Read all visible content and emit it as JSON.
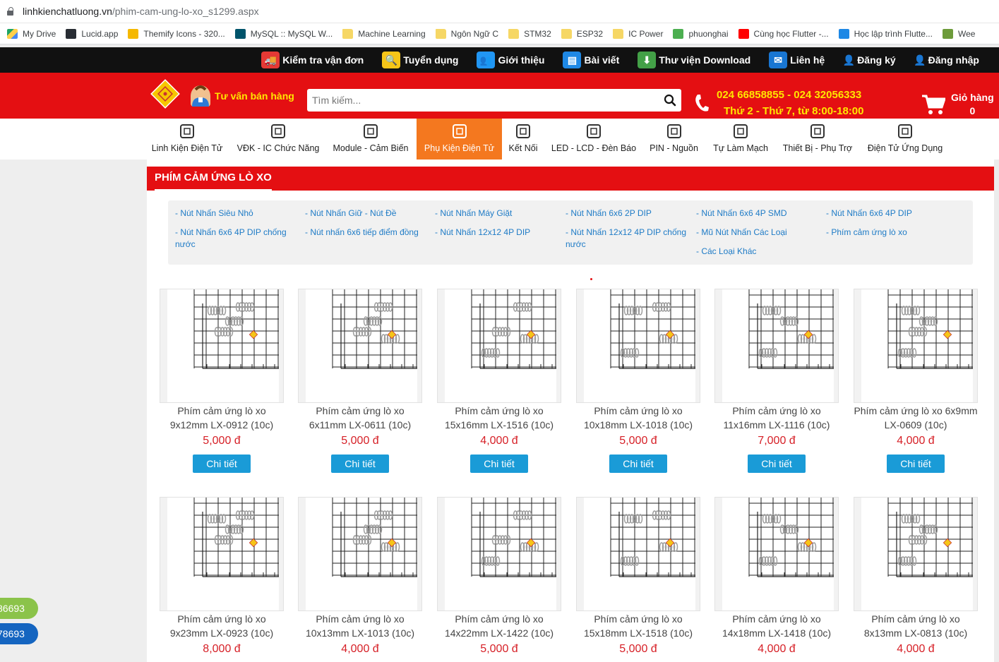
{
  "address_bar": {
    "domain": "linhkienchatluong.vn",
    "path": "/phim-cam-ung-lo-xo_s1299.aspx"
  },
  "bookmarks": [
    {
      "label": "My Drive",
      "icon": "google-drive-icon"
    },
    {
      "label": "Lucid.app",
      "icon": "lucid-icon"
    },
    {
      "label": "Themify Icons - 320...",
      "icon": "emoji-icon"
    },
    {
      "label": "MySQL :: MySQL W...",
      "icon": "mysql-icon"
    },
    {
      "label": "Machine Learning",
      "icon": "folder-icon"
    },
    {
      "label": "Ngôn Ngữ C",
      "icon": "folder-icon"
    },
    {
      "label": "STM32",
      "icon": "folder-icon"
    },
    {
      "label": "ESP32",
      "icon": "folder-icon"
    },
    {
      "label": "IC Power",
      "icon": "folder-icon"
    },
    {
      "label": "phuonghai",
      "icon": "leaf-icon"
    },
    {
      "label": "Cùng học Flutter -...",
      "icon": "youtube-icon"
    },
    {
      "label": "Học lập trình Flutte...",
      "icon": "code-icon"
    },
    {
      "label": "Wee",
      "icon": "plant-icon"
    }
  ],
  "top_nav": [
    {
      "label": "Kiểm tra vận đơn",
      "icon": "truck-icon",
      "color": "#e53935"
    },
    {
      "label": "Tuyển dụng",
      "icon": "magnifier-icon",
      "color": "#f5c518"
    },
    {
      "label": "Giới thiệu",
      "icon": "people-icon",
      "color": "#2196f3"
    },
    {
      "label": "Bài viết",
      "icon": "document-icon",
      "color": "#1e88e5"
    },
    {
      "label": "Thư viện Download",
      "icon": "download-icon",
      "color": "#43a047"
    },
    {
      "label": "Liên hệ",
      "icon": "mail-icon",
      "color": "#1976d2"
    },
    {
      "label": "Đăng ký",
      "icon": "user-plus-icon",
      "color": "#111111"
    },
    {
      "label": "Đăng nhập",
      "icon": "user-icon",
      "color": "#111111"
    }
  ],
  "header": {
    "advisor_label": "Tư vấn bán hàng",
    "search_placeholder": "Tìm kiếm...",
    "phone_line1": "024 66858855 - 024 32056333",
    "phone_line2": "Thứ 2 - Thứ 7, từ 8:00-18:00",
    "cart_label": "Giỏ hàng",
    "cart_count": "0"
  },
  "categories": [
    {
      "label": "Linh Kiện Điện Tử",
      "icon": "resistor-icon",
      "active": false
    },
    {
      "label": "VĐK - IC Chức Năng",
      "icon": "chip-icon",
      "active": false
    },
    {
      "label": "Module - Cảm Biến",
      "icon": "module-icon",
      "active": false
    },
    {
      "label": "Phụ Kiện Điện Tử",
      "icon": "fan-icon",
      "active": true
    },
    {
      "label": "Kết Nối",
      "icon": "connector-icon",
      "active": false
    },
    {
      "label": "LED - LCD - Đèn Báo",
      "icon": "led-icon",
      "active": false
    },
    {
      "label": "PIN - Nguồn",
      "icon": "power-plug-icon",
      "active": false
    },
    {
      "label": "Tự Làm Mạch",
      "icon": "hands-icon",
      "active": false
    },
    {
      "label": "Thiết Bị - Phụ Trợ",
      "icon": "tools-icon",
      "active": false
    },
    {
      "label": "Điện Tử Ứng Dụng",
      "icon": "smart-home-icon",
      "active": false
    }
  ],
  "section": {
    "title": "PHÍM CẢM ỨNG LÒ XO"
  },
  "subcategories": [
    [
      "- Nút Nhấn Siêu Nhỏ",
      "- Nút Nhấn 6x6 4P DIP chống nước"
    ],
    [
      "- Nút Nhấn Giữ - Nút Đề",
      "- Nút nhấn 6x6 tiếp điểm đồng"
    ],
    [
      "- Nút Nhấn Máy Giặt",
      "- Nút Nhấn 12x12 4P DIP"
    ],
    [
      "- Nút Nhấn 6x6 2P DIP",
      "- Nút Nhấn 12x12 4P DIP chống nước"
    ],
    [
      "- Nút Nhấn 6x6 4P SMD",
      "- Mũ Nút Nhấn Các Loại",
      "- Các Loại Khác"
    ],
    [
      "- Nút Nhấn 6x6 4P DIP",
      "- Phím cảm ứng lò xo"
    ]
  ],
  "products": [
    {
      "name_line1": "Phím cảm ứng lò xo",
      "name_line2": "9x12mm LX-0912 (10c)",
      "price": "5,000 đ",
      "button": "Chi tiết"
    },
    {
      "name_line1": "Phím cảm ứng lò xo",
      "name_line2": "6x11mm LX-0611 (10c)",
      "price": "5,000 đ",
      "button": "Chi tiết"
    },
    {
      "name_line1": "Phím cảm ứng lò xo",
      "name_line2": "15x16mm LX-1516 (10c)",
      "price": "4,000 đ",
      "button": "Chi tiết"
    },
    {
      "name_line1": "Phím cảm ứng lò xo",
      "name_line2": "10x18mm LX-1018 (10c)",
      "price": "5,000 đ",
      "button": "Chi tiết"
    },
    {
      "name_line1": "Phím cảm ứng lò xo",
      "name_line2": "11x16mm LX-1116 (10c)",
      "price": "7,000 đ",
      "button": "Chi tiết"
    },
    {
      "name_line1": "Phím cảm ứng lò xo 6x9mm",
      "name_line2": "LX-0609 (10c)",
      "price": "4,000 đ",
      "button": "Chi tiết"
    },
    {
      "name_line1": "Phím cảm ứng lò xo",
      "name_line2": "9x23mm LX-0923 (10c)",
      "price": "8,000 đ",
      "button": "Chi tiết"
    },
    {
      "name_line1": "Phím cảm ứng lò xo",
      "name_line2": "10x13mm LX-1013 (10c)",
      "price": "4,000 đ",
      "button": "Chi tiết"
    },
    {
      "name_line1": "Phím cảm ứng lò xo",
      "name_line2": "14x22mm LX-1422 (10c)",
      "price": "5,000 đ",
      "button": "Chi tiết"
    },
    {
      "name_line1": "Phím cảm ứng lò xo",
      "name_line2": "15x18mm LX-1518 (10c)",
      "price": "5,000 đ",
      "button": "Chi tiết"
    },
    {
      "name_line1": "Phím cảm ứng lò xo",
      "name_line2": "14x18mm LX-1418 (10c)",
      "price": "4,000 đ",
      "button": "Chi tiết"
    },
    {
      "name_line1": "Phím cảm ứng lò xo",
      "name_line2": "8x13mm LX-0813 (10c)",
      "price": "4,000 đ",
      "button": "Chi tiết"
    }
  ],
  "floating_contacts": [
    {
      "label": "86693",
      "color": "#8bc34a"
    },
    {
      "label": "78693",
      "color": "#1565c0"
    }
  ],
  "colors": {
    "brand_red": "#e40f12",
    "active_orange": "#f4781f",
    "button_blue": "#1a9bd7",
    "price_red": "#d61f26",
    "link_blue": "#1e7bc6"
  }
}
